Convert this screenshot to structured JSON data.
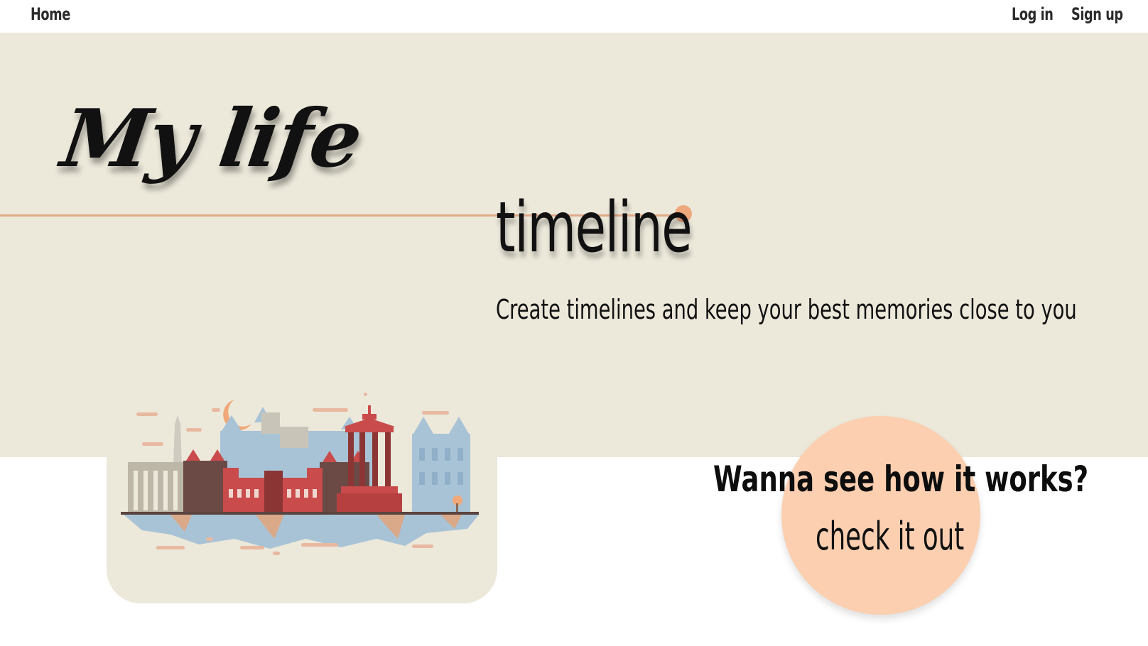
{
  "nav": {
    "home_label": "Home",
    "login_label": "Log in",
    "signup_label": "Sign up"
  },
  "hero": {
    "title": "My life",
    "subtitle": "timeline",
    "tagline": "Create timelines and keep your best memories close to you"
  },
  "cta": {
    "question": "Wanna see how it works?",
    "link_label": "check it out"
  },
  "colors": {
    "hero_background": "#ece8da",
    "timeline_accent": "#e0a98a",
    "cta_circle": "#fbcfb0",
    "text_primary": "#111111"
  }
}
